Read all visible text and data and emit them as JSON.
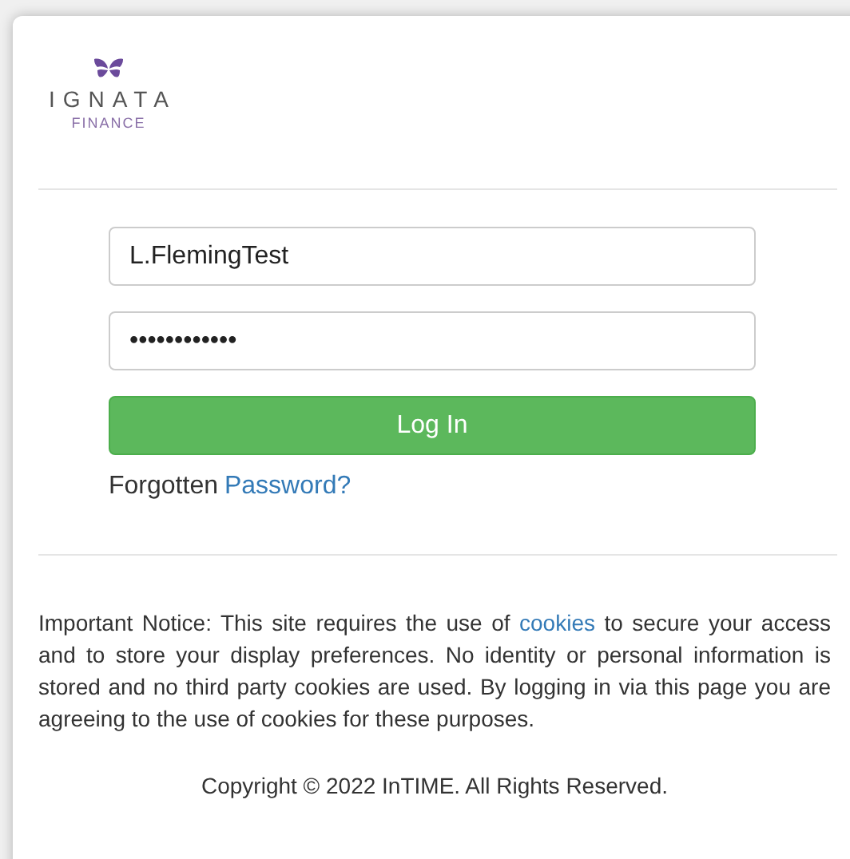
{
  "logo": {
    "name": "IGNATA",
    "subtitle": "FINANCE"
  },
  "login": {
    "username": {
      "value": "L.FlemingTest"
    },
    "password": {
      "value": "••••••••••••"
    },
    "submit": "Log In",
    "forgot": {
      "text": "Forgotten",
      "link": "Password?"
    }
  },
  "notice": {
    "before": "Important Notice: This site requires the use of",
    "link": "cookies",
    "after": "to secure your access and to store your display preferences. No identity or personal information is stored and no third party cookies are used. By logging in via this page you are agreeing to the use of cookies for these purposes."
  },
  "copyright": "Copyright © 2022 InTIME. All Rights Reserved."
}
